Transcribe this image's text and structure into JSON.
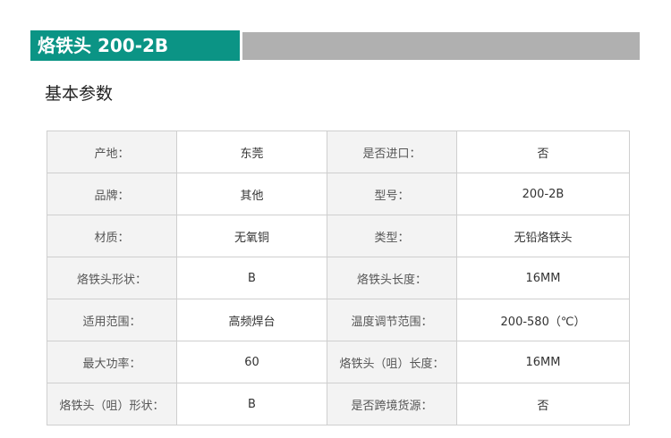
{
  "header": {
    "title": "烙铁头 200-2B"
  },
  "section": {
    "heading": "基本参数"
  },
  "params": [
    [
      {
        "label": "产地：",
        "value": "东莞"
      },
      {
        "label": "是否进口：",
        "value": "否"
      }
    ],
    [
      {
        "label": "品牌：",
        "value": "其他"
      },
      {
        "label": "型号：",
        "value": "200-2B"
      }
    ],
    [
      {
        "label": "材质：",
        "value": "无氧铜"
      },
      {
        "label": "类型：",
        "value": "无铅烙铁头"
      }
    ],
    [
      {
        "label": "烙铁头形状：",
        "value": "B"
      },
      {
        "label": "烙铁头长度：",
        "value": "16MM"
      }
    ],
    [
      {
        "label": "适用范围：",
        "value": "高频焊台"
      },
      {
        "label": "温度调节范围：",
        "value": "200-580（℃）"
      }
    ],
    [
      {
        "label": "最大功率：",
        "value": "60"
      },
      {
        "label": "烙铁头（咀）长度：",
        "value": "16MM"
      }
    ],
    [
      {
        "label": "烙铁头（咀）形状：",
        "value": "B"
      },
      {
        "label": "是否跨境货源：",
        "value": "否"
      }
    ]
  ],
  "colors": {
    "accent": "#0b9485",
    "bar_gray": "#b0b0b0",
    "label_bg": "#f3f3f3",
    "border": "#cfcfcf"
  }
}
